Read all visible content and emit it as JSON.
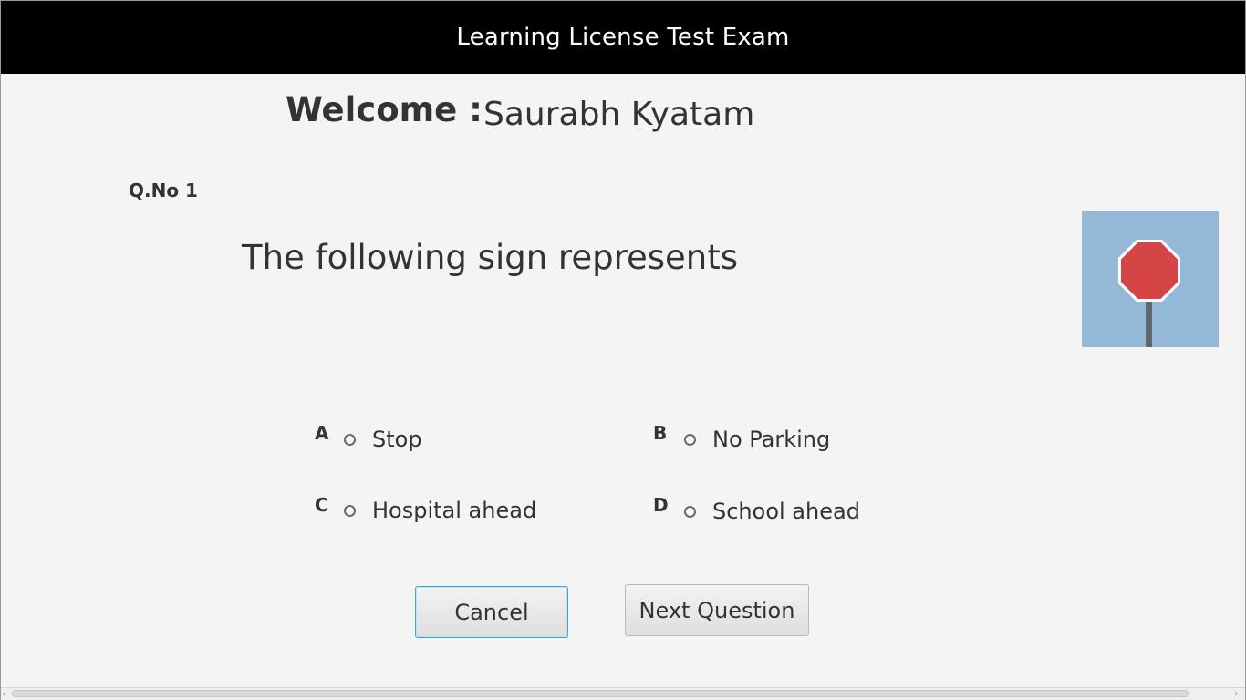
{
  "window": {
    "title": "Learning License Test Exam"
  },
  "welcome": {
    "label": "Welcome :",
    "user_name": "Saurabh Kyatam"
  },
  "question": {
    "number_label": "Q.No",
    "number": "1",
    "text": "The following sign represents",
    "image_icon": "stop-sign-icon"
  },
  "options": [
    {
      "letter": "A",
      "text": "Stop",
      "selected": false
    },
    {
      "letter": "B",
      "text": "No Parking",
      "selected": false
    },
    {
      "letter": "C",
      "text": "Hospital ahead",
      "selected": false
    },
    {
      "letter": "D",
      "text": "School ahead",
      "selected": false
    }
  ],
  "buttons": {
    "cancel": "Cancel",
    "next": "Next Question"
  },
  "colors": {
    "titlebar_bg": "#000000",
    "title_text": "#ffffff",
    "background": "#f4f4f4",
    "sign_bg": "#93b9d6",
    "sign_red": "#d64545",
    "focus_border": "#3ea6d6"
  }
}
